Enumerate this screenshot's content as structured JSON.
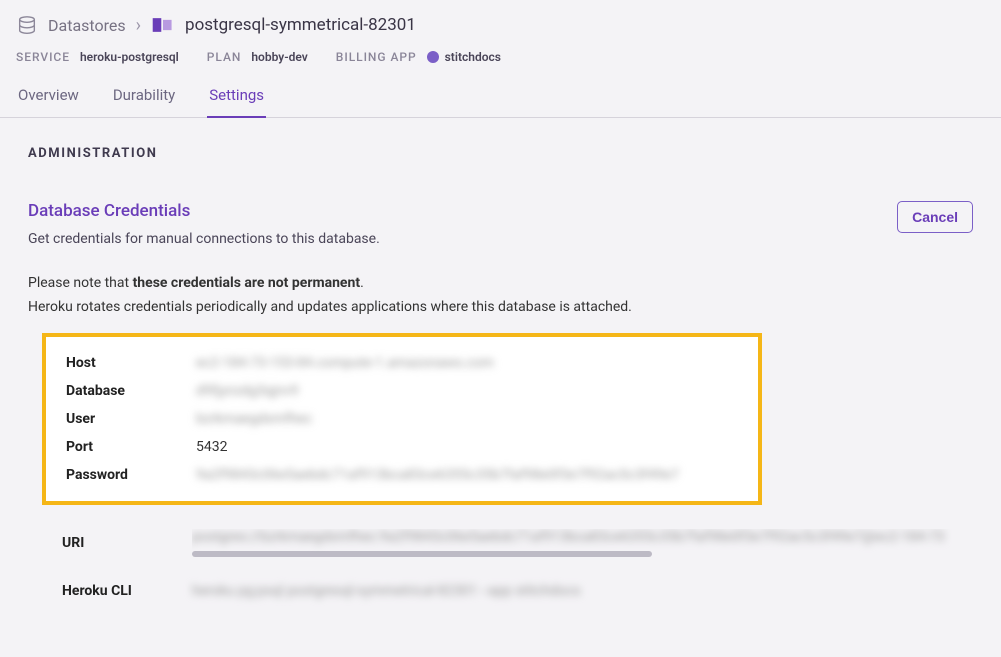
{
  "breadcrumb": {
    "datastores_label": "Datastores",
    "resource_name": "postgresql-symmetrical-82301"
  },
  "meta": {
    "service_label": "SERVICE",
    "service_value": "heroku-postgresql",
    "plan_label": "PLAN",
    "plan_value": "hobby-dev",
    "billing_label": "BILLING APP",
    "billing_value": "stitchdocs"
  },
  "tabs": {
    "overview": "Overview",
    "durability": "Durability",
    "settings": "Settings"
  },
  "admin_heading": "ADMINISTRATION",
  "credentials": {
    "heading": "Database Credentials",
    "subheading": "Get credentials for manual connections to this database.",
    "cancel_label": "Cancel",
    "note_prefix": "Please note that ",
    "note_bold": "these credentials are not permanent",
    "note_suffix": ".",
    "rotate_note": "Heroku rotates credentials periodically and updates applications where this database is attached.",
    "fields": {
      "host_label": "Host",
      "host_value": "ec2-184-73-153-84.compute-1.amazonaws.com",
      "database_label": "Database",
      "database_value": "d9fjynzdg3qjnv9",
      "user_label": "User",
      "user_value": "bzrkmaegdxmfhec",
      "port_label": "Port",
      "port_value": "5432",
      "password_label": "Password",
      "password_value": "9a2f9843c06e5aebdc71af913bca83ce6355c35b7faf98e0f3e7f92acSc3f49e7",
      "uri_label": "URI",
      "uri_value": "postgres://bzrkmaegdxmfhec:9a2f9843c06e5aebdc71af913bca83ce6355c35b7faf98e0f3e7f92ac5c3f49e7@ec2-184-73",
      "cli_label": "Heroku CLI",
      "cli_value": "heroku pg:psql postgresql-symmetrical-82301 --app stitchdocs"
    }
  }
}
